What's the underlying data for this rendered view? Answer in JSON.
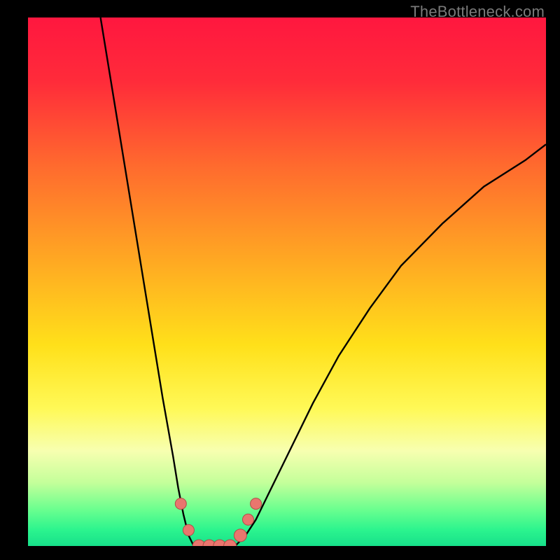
{
  "watermark": "TheBottleneck.com",
  "colors": {
    "gradient_stops": [
      {
        "offset": 0.0,
        "color": "#ff173f"
      },
      {
        "offset": 0.12,
        "color": "#ff2b3a"
      },
      {
        "offset": 0.28,
        "color": "#ff6a2e"
      },
      {
        "offset": 0.45,
        "color": "#ffa523"
      },
      {
        "offset": 0.62,
        "color": "#ffe01a"
      },
      {
        "offset": 0.74,
        "color": "#fff957"
      },
      {
        "offset": 0.82,
        "color": "#f7ffb0"
      },
      {
        "offset": 0.88,
        "color": "#c4ff9a"
      },
      {
        "offset": 0.93,
        "color": "#6cff8f"
      },
      {
        "offset": 0.97,
        "color": "#2bf48e"
      },
      {
        "offset": 1.0,
        "color": "#17e08a"
      }
    ],
    "curve": "#000000",
    "marker_fill": "#e9766e",
    "marker_stroke": "#b04e47",
    "frame": "#000000"
  },
  "chart_data": {
    "type": "line",
    "title": "",
    "xlabel": "",
    "ylabel": "",
    "xlim": [
      0,
      100
    ],
    "ylim": [
      0,
      100
    ],
    "grid": false,
    "legend": false,
    "series": [
      {
        "name": "left-branch",
        "x": [
          14,
          16,
          18,
          20,
          22,
          24,
          26,
          28,
          29,
          30,
          31,
          32
        ],
        "y": [
          100,
          88,
          76,
          64,
          52,
          40,
          28,
          17,
          11,
          6,
          2,
          0
        ]
      },
      {
        "name": "valley-floor",
        "x": [
          32,
          34,
          36,
          38,
          40
        ],
        "y": [
          0,
          0,
          0,
          0,
          0
        ]
      },
      {
        "name": "right-branch",
        "x": [
          40,
          42,
          44,
          46,
          50,
          55,
          60,
          66,
          72,
          80,
          88,
          96,
          100
        ],
        "y": [
          0,
          2,
          5,
          9,
          17,
          27,
          36,
          45,
          53,
          61,
          68,
          73,
          76
        ]
      }
    ],
    "markers": {
      "name": "data-points",
      "x": [
        29.5,
        31,
        33,
        35,
        37,
        39,
        41,
        42.5,
        44
      ],
      "y": [
        8,
        3,
        0,
        0,
        0,
        0,
        2,
        5,
        8
      ],
      "r": [
        8,
        8,
        9,
        9,
        9,
        9,
        9,
        8,
        8
      ]
    }
  }
}
